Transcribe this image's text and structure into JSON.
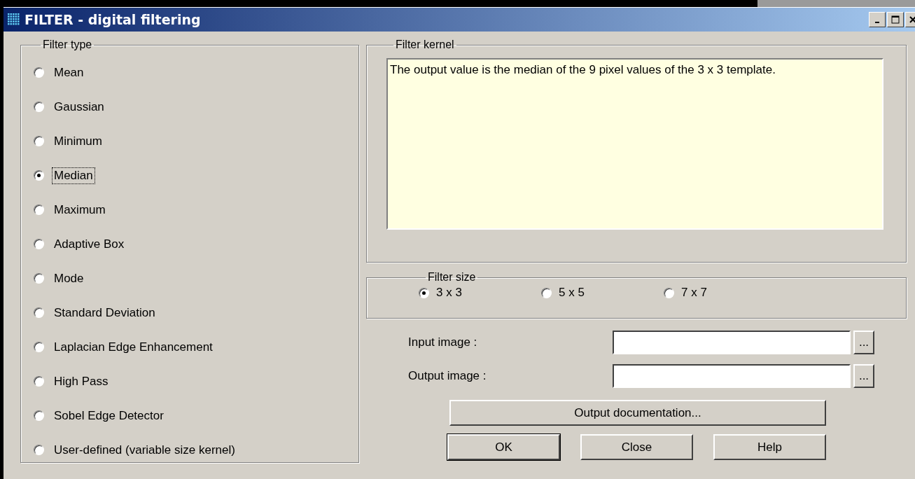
{
  "window": {
    "title": "FILTER - digital filtering"
  },
  "filter_type": {
    "label": "Filter type",
    "options": [
      {
        "label": "Mean",
        "selected": false
      },
      {
        "label": "Gaussian",
        "selected": false
      },
      {
        "label": "Minimum",
        "selected": false
      },
      {
        "label": "Median",
        "selected": true
      },
      {
        "label": "Maximum",
        "selected": false
      },
      {
        "label": "Adaptive Box",
        "selected": false
      },
      {
        "label": "Mode",
        "selected": false
      },
      {
        "label": "Standard Deviation",
        "selected": false
      },
      {
        "label": "Laplacian Edge Enhancement",
        "selected": false
      },
      {
        "label": "High Pass",
        "selected": false
      },
      {
        "label": "Sobel Edge Detector",
        "selected": false
      },
      {
        "label": "User-defined (variable size kernel)",
        "selected": false
      }
    ]
  },
  "filter_kernel": {
    "label": "Filter kernel",
    "text": "The output value is the median of the 9 pixel values of the 3 x 3 template."
  },
  "filter_size": {
    "label": "Filter size",
    "options": [
      {
        "label": "3 x 3",
        "selected": true
      },
      {
        "label": "5 x 5",
        "selected": false
      },
      {
        "label": "7 x 7",
        "selected": false
      }
    ]
  },
  "files": [
    {
      "label": "Input image :",
      "browse": "..."
    },
    {
      "label": "Output image :",
      "browse": "..."
    }
  ],
  "doc_button": "Output documentation...",
  "buttons": [
    {
      "label": "OK",
      "default": true
    },
    {
      "label": "Close",
      "default": false
    },
    {
      "label": "Help",
      "default": false
    }
  ]
}
